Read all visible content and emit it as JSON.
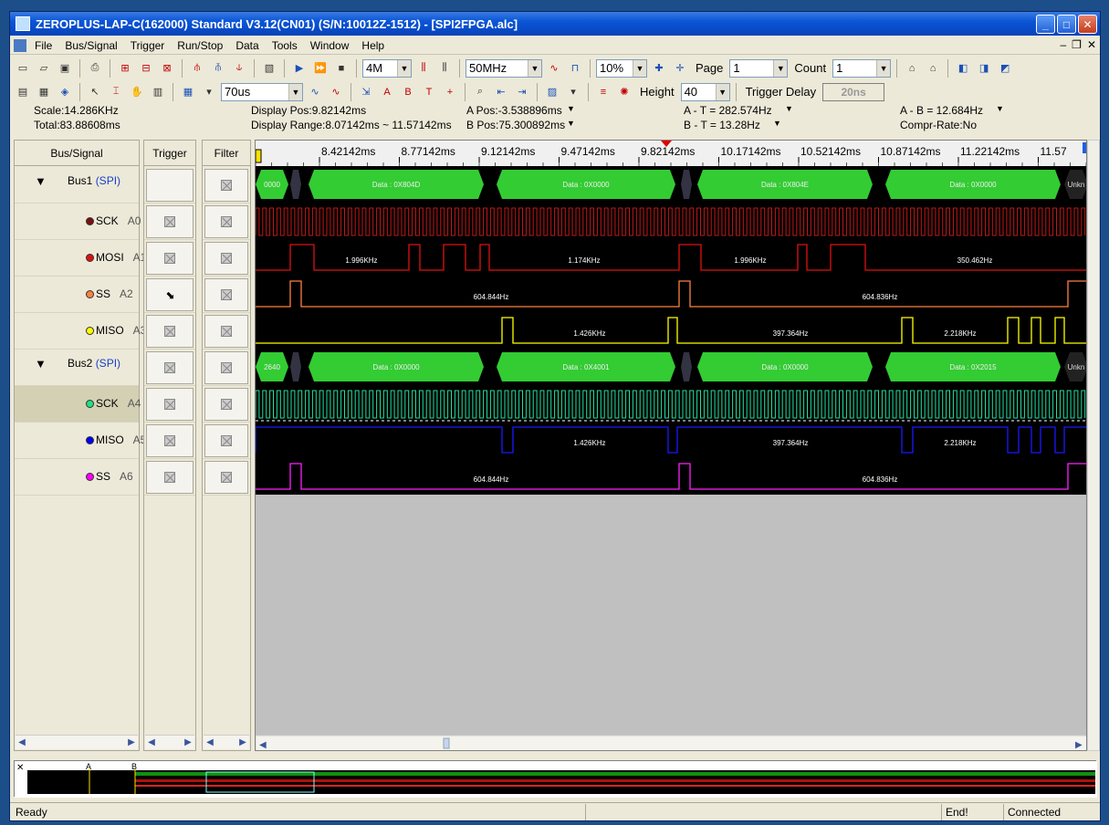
{
  "window": {
    "title": "ZEROPLUS-LAP-C(162000) Standard V3.12(CN01) (S/N:10012Z-1512) - [SPI2FPGA.alc]"
  },
  "menu": [
    "File",
    "Bus/Signal",
    "Trigger",
    "Run/Stop",
    "Data",
    "Tools",
    "Window",
    "Help"
  ],
  "toolbar": {
    "memory_depth": "4M",
    "sample_rate": "50MHz",
    "trigger_position": "10%",
    "page_label": "Page",
    "page_value": "1",
    "count_label": "Count",
    "count_value": "1",
    "time_div": "70us",
    "height_label": "Height",
    "height_value": "40",
    "trigger_delay_label": "Trigger Delay",
    "trigger_delay_value": "20ns"
  },
  "info": {
    "scale": "Scale:14.286KHz",
    "total": "Total:83.88608ms",
    "display_pos": "Display Pos:9.82142ms",
    "display_range": "Display Range:8.07142ms ~ 11.57142ms",
    "a_pos": "A Pos:-3.538896ms",
    "b_pos": "B Pos:75.300892ms",
    "a_t": "A - T = 282.574Hz",
    "b_t": "B - T = 13.28Hz",
    "a_b": "A - B = 12.684Hz",
    "compr_rate": "Compr-Rate:No"
  },
  "columns": {
    "bus_signal": "Bus/Signal",
    "trigger": "Trigger",
    "filter": "Filter"
  },
  "rows": [
    {
      "type": "bus",
      "name": "Bus1",
      "proto": "(SPI)"
    },
    {
      "type": "sig",
      "name": "SCK",
      "ch": "A0",
      "color": "#7a1010",
      "trig": "x"
    },
    {
      "type": "sig",
      "name": "MOSI",
      "ch": "A1",
      "color": "#e01010",
      "trig": "x"
    },
    {
      "type": "sig",
      "name": "SS",
      "ch": "A2",
      "color": "#ff8040",
      "trig": "fall"
    },
    {
      "type": "sig",
      "name": "MISO",
      "ch": "A3",
      "color": "#ffff00",
      "trig": "x"
    },
    {
      "type": "bus",
      "name": "Bus2",
      "proto": "(SPI)"
    },
    {
      "type": "sig",
      "name": "SCK",
      "ch": "A4",
      "color": "#20e080",
      "trig": "x",
      "selected": true
    },
    {
      "type": "sig",
      "name": "MISO",
      "ch": "A5",
      "color": "#0000ff",
      "trig": "x"
    },
    {
      "type": "sig",
      "name": "SS",
      "ch": "A6",
      "color": "#ff00ff",
      "trig": "x"
    }
  ],
  "time_ticks": [
    "8.42142ms",
    "8.77142ms",
    "9.12142ms",
    "9.47142ms",
    "9.82142ms",
    "10.17142ms",
    "10.52142ms",
    "10.87142ms",
    "11.22142ms",
    "11.57"
  ],
  "bus1_packets": [
    "0000",
    "Data : 0X804D",
    "Data : 0X0000",
    "Data : 0X804E",
    "Data : 0X0000",
    "Unkn"
  ],
  "bus2_packets": [
    "2640",
    "Data : 0X0000",
    "Data : 0X4001",
    "Data : 0X0000",
    "Data : 0X2015",
    "Unkn"
  ],
  "freq_labels": {
    "mosi": [
      "1.996KHz",
      "1.174KHz",
      "1.996KHz",
      "350.462Hz"
    ],
    "ss": [
      "604.844Hz",
      "604.836Hz"
    ],
    "miso": [
      "1.426KHz",
      "397.364Hz",
      "2.218KHz"
    ],
    "miso2": [
      "1.426KHz",
      "397.364Hz",
      "2.218KHz"
    ],
    "ss2": [
      "604.844Hz",
      "604.836Hz"
    ]
  },
  "overview_markers": [
    "A",
    "B"
  ],
  "status": {
    "ready": "Ready",
    "end": "End!",
    "connected": "Connected"
  }
}
